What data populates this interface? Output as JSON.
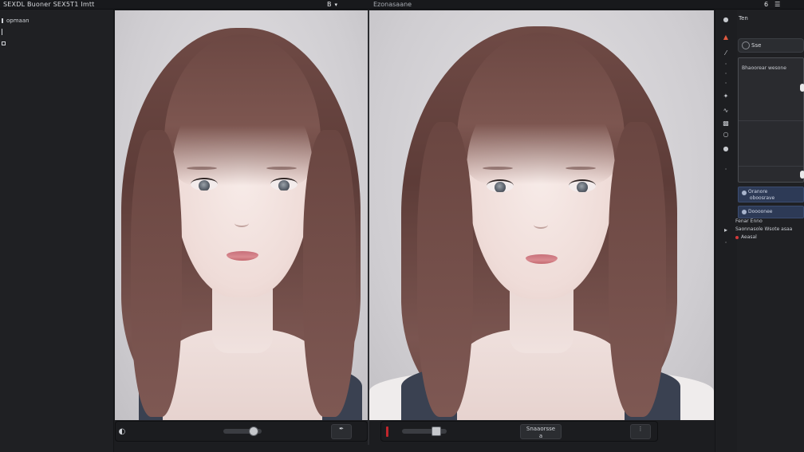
{
  "app": {
    "title": "SEXDL Buoner SEX5T1 Imtt",
    "tab_left_icon": "B",
    "tab_left_menu": "▾",
    "tab_right": "Ezonasaane",
    "top_right_icons": [
      "6",
      "☰"
    ]
  },
  "left_panel": {
    "items": [
      {
        "icon": "menu-icon",
        "label": "opmaan"
      },
      {
        "icon": "info-icon",
        "label": ""
      },
      {
        "icon": "square-icon",
        "label": ""
      }
    ]
  },
  "bottom_left": {
    "slider_value": 0.88,
    "tool_icon": "✒"
  },
  "bottom_right": {
    "slider_value": 0.85,
    "button_line1": "Snaaorsse",
    "button_line2": "a"
  },
  "right_panel": {
    "header": "Ten",
    "field_label": "Sse",
    "box_label": "Bhaoorear wesone",
    "blue_rows": [
      "Oranore\n oboosrave",
      "Doooonee"
    ],
    "text_lines": [
      "Fenar Enno",
      "Saonnasole Wsote asaa",
      "Aeasal"
    ]
  },
  "colors": {
    "accent_red": "#c2262c",
    "panel_bg": "#1f2023",
    "blue_row": "#2d3a56"
  }
}
